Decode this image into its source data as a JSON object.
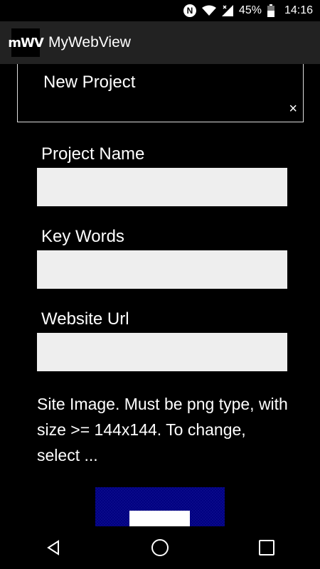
{
  "status_bar": {
    "battery_percent": "45%",
    "time": "14:16",
    "nfc_label": "N",
    "icons": [
      "nfc-icon",
      "wifi-icon",
      "signal-icon",
      "battery-icon"
    ]
  },
  "app_bar": {
    "logo_text": "mWV",
    "title": "MyWebView"
  },
  "tab": {
    "title": "New Project",
    "close_glyph": "×"
  },
  "form": {
    "project_name": {
      "label": "Project Name",
      "value": ""
    },
    "key_words": {
      "label": "Key Words",
      "value": ""
    },
    "website_url": {
      "label": "Website Url",
      "value": ""
    },
    "site_image_note": "Site Image. Must be png type, with size >= 144x144. To change, select ..."
  },
  "colors": {
    "background": "#000000",
    "app_bar": "#222222",
    "input_fill": "#eeeeee",
    "image_blue": "#0a0a8a"
  },
  "nav_bar": {
    "icons": [
      "back-icon",
      "home-icon",
      "recents-icon"
    ]
  }
}
